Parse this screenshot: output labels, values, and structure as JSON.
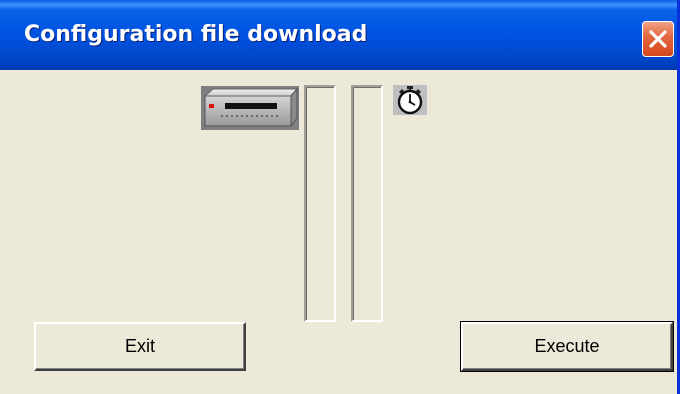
{
  "window": {
    "title": "Configuration file download",
    "accent_color": "#0054e3",
    "close_color": "#e56a43"
  },
  "icons": {
    "device": "network-device-icon",
    "timer": "stopwatch-icon"
  },
  "gauges": [
    {
      "name": "transfer-progress",
      "fill": 0
    },
    {
      "name": "time-progress",
      "fill": 0
    }
  ],
  "buttons": {
    "exit_label": "Exit",
    "execute_label": "Execute"
  }
}
